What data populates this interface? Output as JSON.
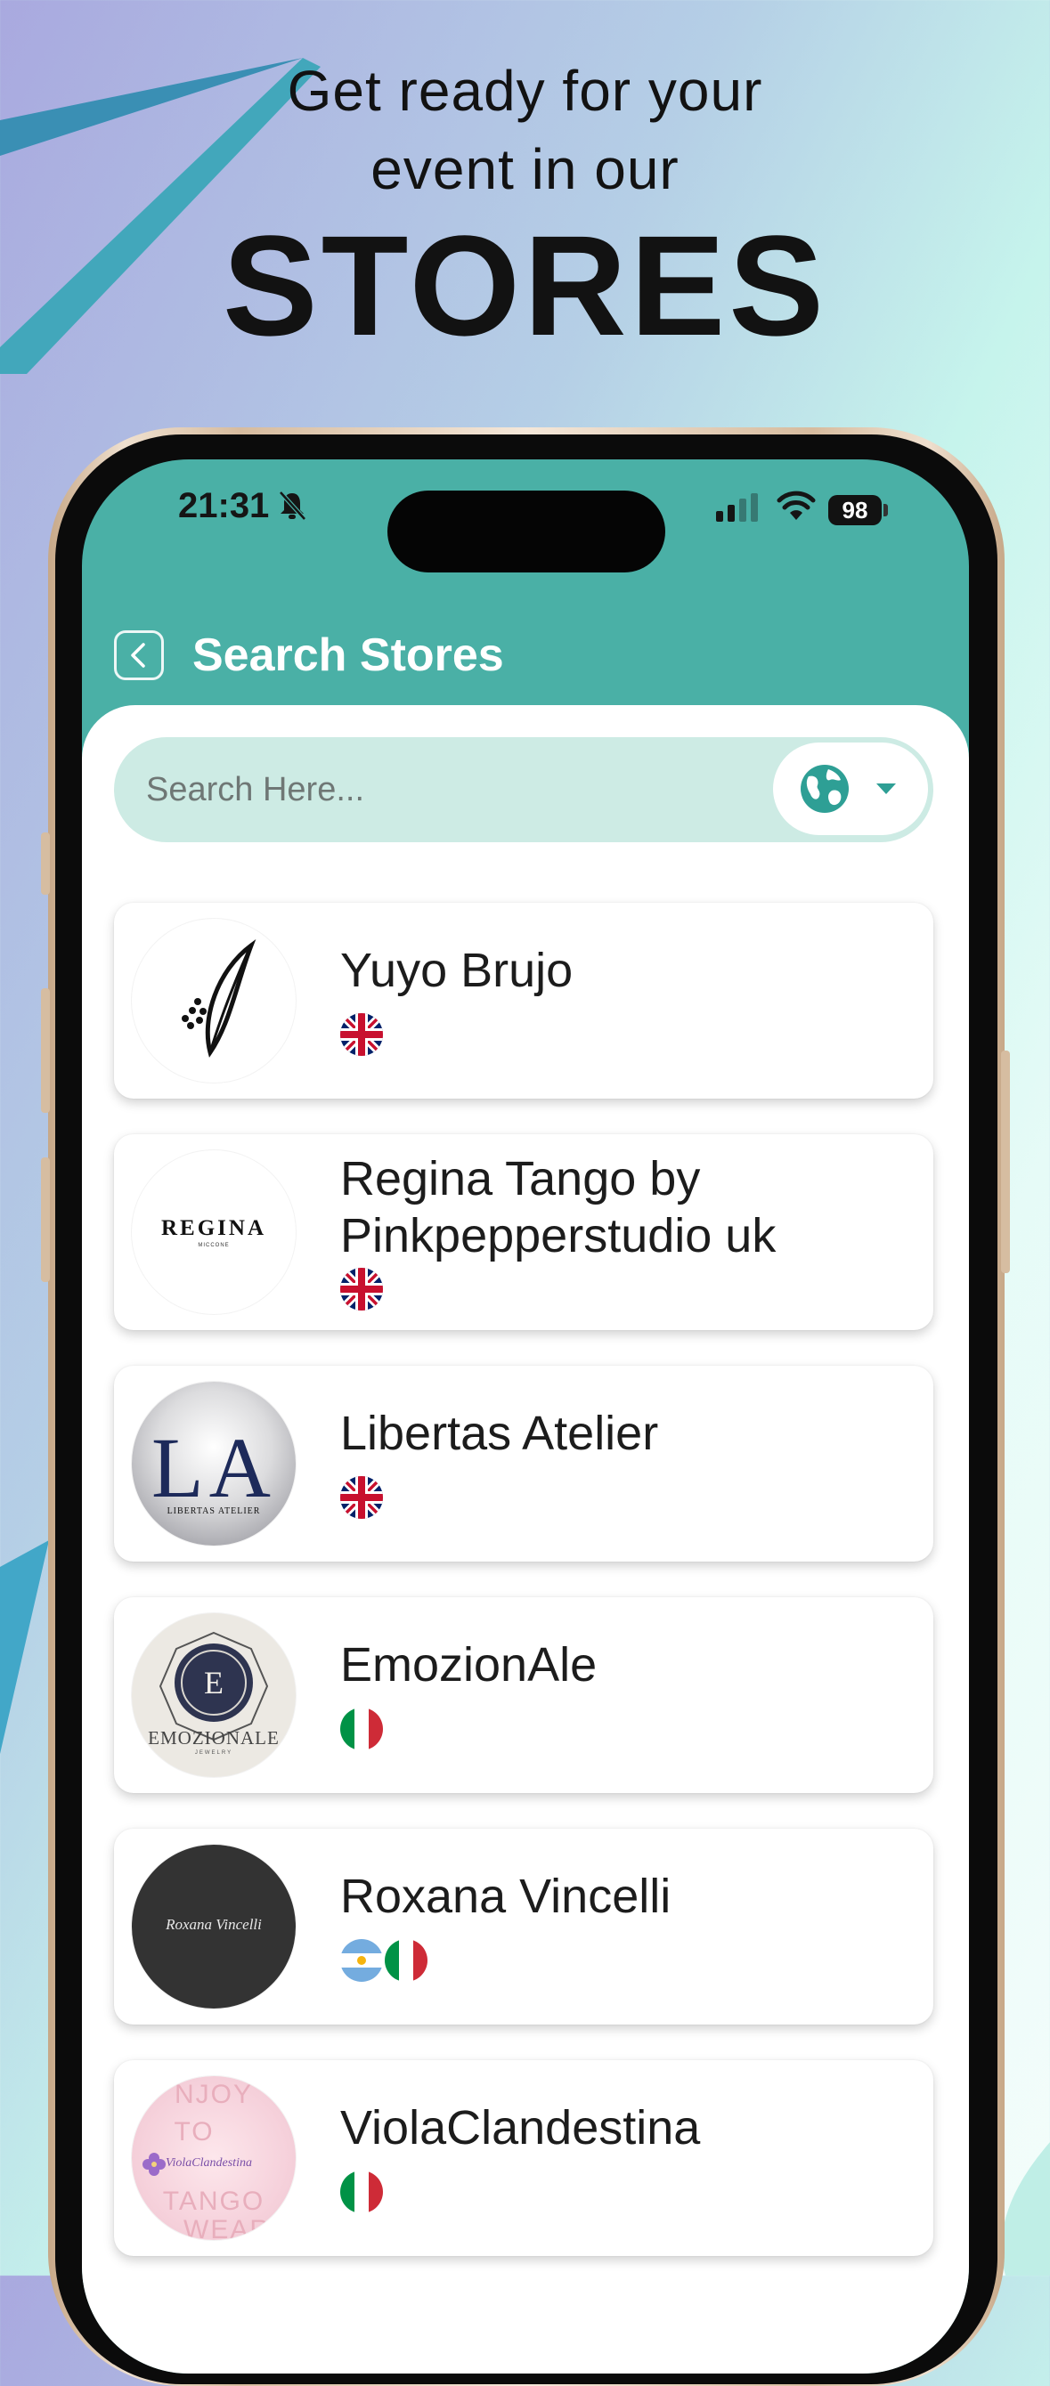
{
  "promo": {
    "line1": "Get ready for your",
    "line2": "event in our",
    "headline": "STORES"
  },
  "status_bar": {
    "time": "21:31",
    "battery": "98"
  },
  "header": {
    "title": "Search Stores",
    "back_icon": "chevron-left-icon"
  },
  "search": {
    "placeholder": "Search Here...",
    "region_icon": "globe-icon"
  },
  "stores": [
    {
      "name": "Yuyo Brujo",
      "flags": [
        "uk"
      ]
    },
    {
      "name": "Regina Tango by Pinkpepperstudio uk",
      "flags": [
        "uk"
      ],
      "logo_text": "REGINA",
      "logo_subtext": "MICCONE"
    },
    {
      "name": "Libertas Atelier",
      "flags": [
        "uk"
      ],
      "logo_text": "LA",
      "logo_subtext": "LIBERTAS ATELIER"
    },
    {
      "name": "EmozionAle",
      "flags": [
        "italy"
      ],
      "logo_text": "E",
      "logo_subtext": "EMOZIONALE",
      "logo_subtext2": "JEWELRY"
    },
    {
      "name": "Roxana Vincelli",
      "flags": [
        "argentina",
        "italy"
      ],
      "logo_text": "Roxana Vincelli"
    },
    {
      "name": "ViolaClandestina",
      "flags": [
        "italy"
      ],
      "logo_text": "ViolaClandestina",
      "logo_bg_text": [
        "NJOY",
        "TO",
        "TANGO",
        "WEAR"
      ]
    }
  ],
  "colors": {
    "accent": "#4ab0a6",
    "search_bg": "#cdebe4",
    "card_bg": "#ffffff"
  }
}
